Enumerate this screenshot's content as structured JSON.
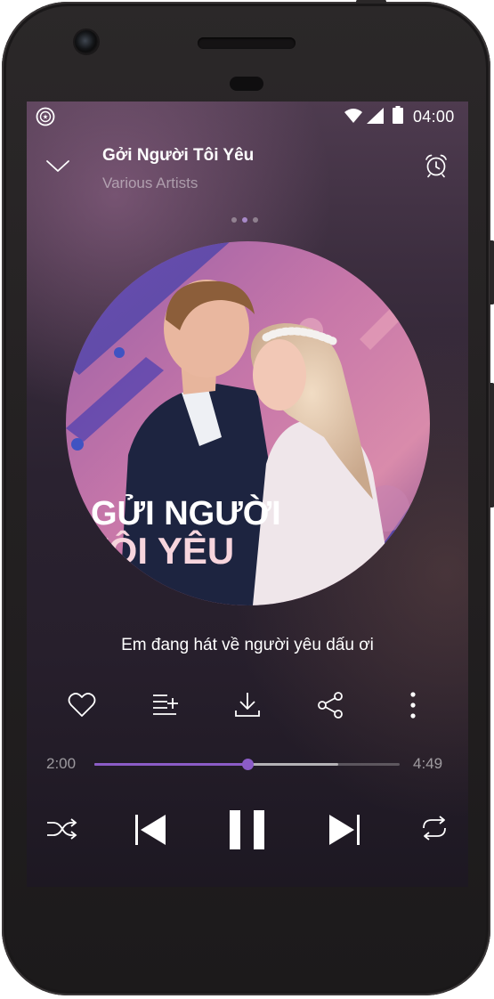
{
  "status_bar": {
    "time": "04:00",
    "app_icon": "music-disc-icon",
    "wifi_icon": "wifi-icon",
    "signal_icon": "cell-signal-icon",
    "battery_icon": "battery-icon"
  },
  "header": {
    "collapse_icon": "chevron-down-icon",
    "title": "Gởi Người Tôi Yêu",
    "artist": "Various Artists",
    "alarm_icon": "alarm-clock-icon"
  },
  "pager": {
    "count": 3,
    "active_index": 1
  },
  "artwork": {
    "title_line_1": "GỬI NGƯỜI",
    "title_line_2": "TÔI YÊU"
  },
  "lyric": "Em đang hát về người yêu dấu ơi",
  "actions": [
    {
      "name": "favorite",
      "icon": "heart-icon"
    },
    {
      "name": "add-to-playlist",
      "icon": "playlist-add-icon"
    },
    {
      "name": "download",
      "icon": "download-icon"
    },
    {
      "name": "share",
      "icon": "share-icon"
    },
    {
      "name": "more",
      "icon": "more-vertical-icon"
    }
  ],
  "progress": {
    "current_time": "2:00",
    "total_time": "4:49",
    "played_fraction": 0.5,
    "buffered_fraction": 0.8
  },
  "controls": [
    {
      "name": "shuffle",
      "icon": "shuffle-icon"
    },
    {
      "name": "previous",
      "icon": "skip-previous-icon"
    },
    {
      "name": "pause",
      "icon": "pause-icon"
    },
    {
      "name": "next",
      "icon": "skip-next-icon"
    },
    {
      "name": "repeat",
      "icon": "repeat-icon"
    }
  ],
  "colors": {
    "accent": "#8b5cc7",
    "pager_active": "#a889c8",
    "background_top": "#4e3b4f",
    "background_bottom": "#1d1822",
    "artwork_title_white": "#ffffff",
    "artwork_title_pink": "#f7d5dd"
  }
}
